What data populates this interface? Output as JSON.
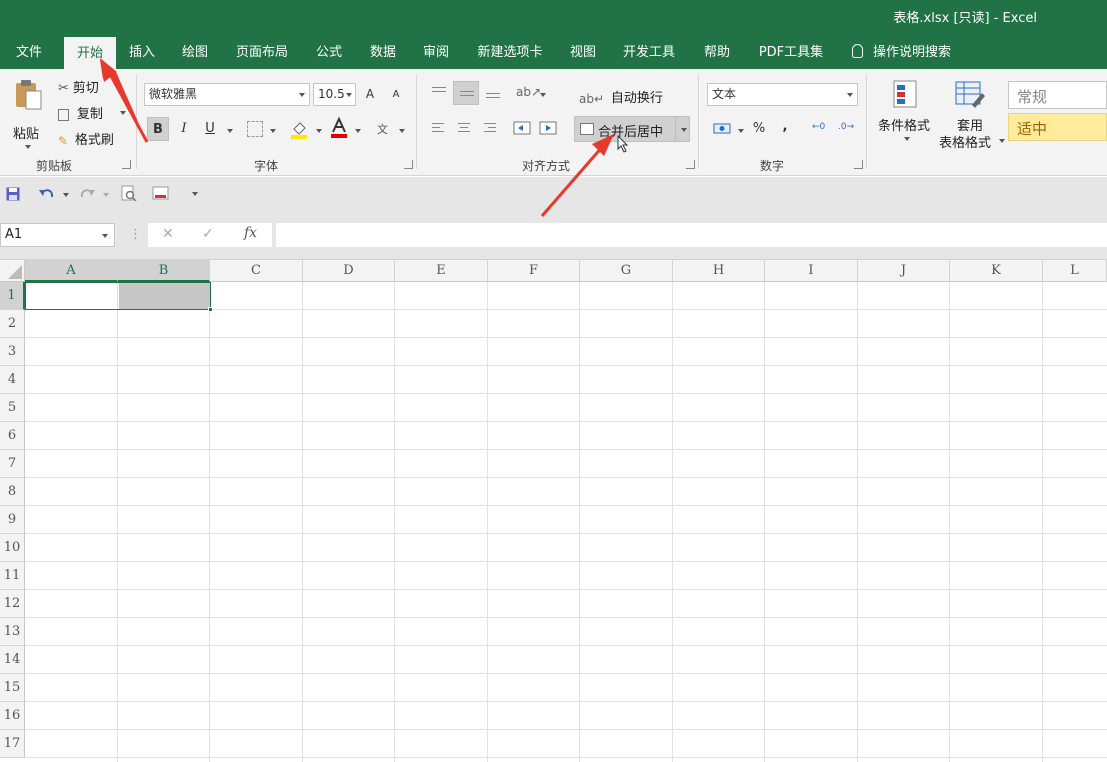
{
  "window": {
    "title": "表格.xlsx  [只读]  -  Excel"
  },
  "tabs": [
    "文件",
    "开始",
    "插入",
    "绘图",
    "页面布局",
    "公式",
    "数据",
    "审阅",
    "新建选项卡",
    "视图",
    "开发工具",
    "帮助",
    "PDF工具集"
  ],
  "active_tab": "开始",
  "tell_me": "操作说明搜索",
  "clipboard": {
    "paste": "粘贴",
    "cut": "剪切",
    "copy": "复制",
    "format_painter": "格式刷",
    "label": "剪贴板"
  },
  "font": {
    "name": "微软雅黑",
    "size": "10.5",
    "bold": "B",
    "italic": "I",
    "underline": "U",
    "grow": "A",
    "shrink": "A",
    "label": "字体"
  },
  "alignment": {
    "wrap_text": "自动换行",
    "merge_center": "合并后居中",
    "label": "对齐方式"
  },
  "number": {
    "format": "文本",
    "percent": "%",
    "comma": ",",
    "label": "数字"
  },
  "styles": {
    "conditional": "条件格式",
    "table_format_line1": "套用",
    "table_format_line2": "表格格式",
    "normal": "常规",
    "neutral": "适中"
  },
  "formula_bar": {
    "name_box": "A1",
    "fx": "fx",
    "value": ""
  },
  "columns": [
    "A",
    "B",
    "C",
    "D",
    "E",
    "F",
    "G",
    "H",
    "I",
    "J",
    "K",
    "L"
  ],
  "rows": [
    "1",
    "2",
    "3",
    "4",
    "5",
    "6",
    "7",
    "8",
    "9",
    "10",
    "11",
    "12",
    "13",
    "14",
    "15",
    "16",
    "17"
  ],
  "colors": {
    "excel_green": "#217346",
    "arrow_red": "#e8392d"
  }
}
